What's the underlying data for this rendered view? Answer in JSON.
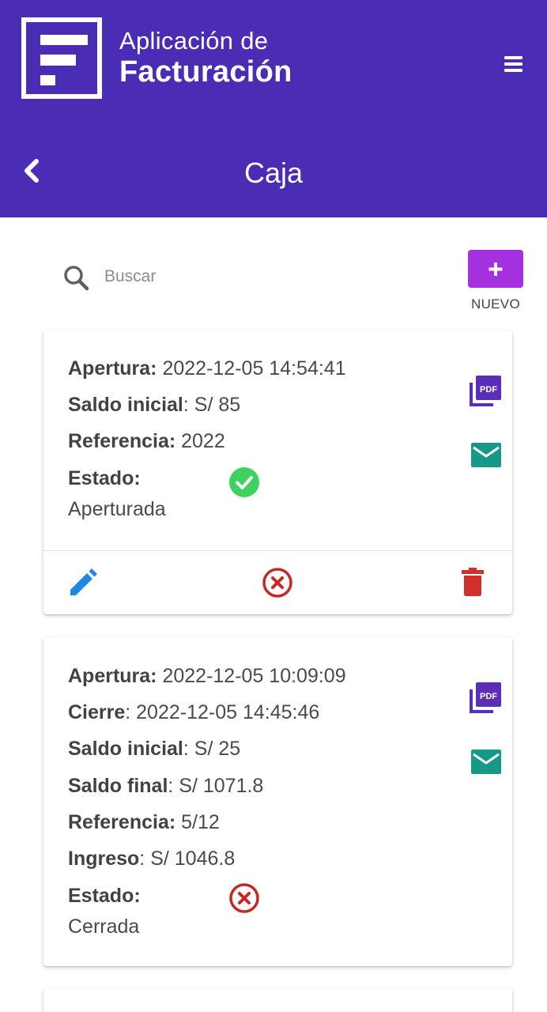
{
  "header": {
    "app_name_line1": "Aplicación de",
    "app_name_line2": "Facturación",
    "page_title": "Caja"
  },
  "search": {
    "placeholder": "Buscar",
    "value": ""
  },
  "new_button": {
    "label": "NUEVO"
  },
  "colors": {
    "header_bg": "#4a2db4",
    "new_button": "#a530e0",
    "pdf_icon": "#5b2fb5",
    "mail_icon": "#17998a",
    "status_open": "#3fd15e",
    "status_closed": "#c62828",
    "edit_icon": "#1e88e5",
    "delete_icon": "#d32f2f"
  },
  "records": [
    {
      "apertura_label": "Apertura:",
      "apertura_value": " 2022-12-05 14:54:41",
      "saldo_inicial_label": "Saldo inicial",
      "saldo_inicial_value": ": S/ 85",
      "referencia_label": "Referencia:",
      "referencia_value": " 2022",
      "estado_label": "Estado:",
      "estado_value": "Aperturada",
      "status_icon": "check-circle-icon",
      "actions": [
        "pencil-icon",
        "cancel-circle-icon",
        "trash-icon"
      ]
    },
    {
      "apertura_label": "Apertura:",
      "apertura_value": " 2022-12-05 10:09:09",
      "cierre_label": "Cierre",
      "cierre_value": ": 2022-12-05 14:45:46",
      "saldo_inicial_label": "Saldo inicial",
      "saldo_inicial_value": ": S/ 25",
      "saldo_final_label": "Saldo final",
      "saldo_final_value": ": S/ 1071.8",
      "referencia_label": "Referencia:",
      "referencia_value": " 5/12",
      "ingreso_label": "Ingreso",
      "ingreso_value": ": S/ 1046.8",
      "estado_label": "Estado:",
      "estado_value": "Cerrada",
      "status_icon": "cancel-circle-icon"
    }
  ]
}
